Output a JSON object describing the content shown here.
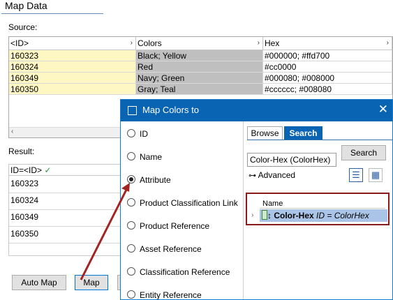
{
  "page": {
    "title": "Map Data"
  },
  "source": {
    "label": "Source:",
    "columns": [
      "<ID>",
      "Colors",
      "Hex"
    ],
    "rows": [
      {
        "id": "160323",
        "colors": "Black; Yellow",
        "hex": "#000000; #ffd700"
      },
      {
        "id": "160324",
        "colors": "Red",
        "hex": "#cc0000"
      },
      {
        "id": "160349",
        "colors": "Navy; Green",
        "hex": "#000080; #008000"
      },
      {
        "id": "160350",
        "colors": "Gray; Teal",
        "hex": "#cccccc; #008080"
      }
    ]
  },
  "result": {
    "label": "Result:",
    "header": "ID=<ID>",
    "header_check": "✓",
    "rows": [
      "160323",
      "160324",
      "160349",
      "160350"
    ]
  },
  "buttons": {
    "auto_map": "Auto Map",
    "map": "Map"
  },
  "dialog": {
    "title": "Map Colors to",
    "close": "✕",
    "options": [
      {
        "label": "ID",
        "selected": false
      },
      {
        "label": "Name",
        "selected": false
      },
      {
        "label": "Attribute",
        "selected": true
      },
      {
        "label": "Product Classification Link",
        "selected": false
      },
      {
        "label": "Product Reference",
        "selected": false
      },
      {
        "label": "Asset Reference",
        "selected": false
      },
      {
        "label": "Classification Reference",
        "selected": false
      },
      {
        "label": "Entity Reference",
        "selected": false
      }
    ],
    "tabs": {
      "browse": "Browse",
      "search": "Search"
    },
    "search_value": "Color-Hex (ColorHex)",
    "search_button": "Search",
    "advanced": "Advanced",
    "results": {
      "column": "Name",
      "item_name": "Color-Hex",
      "item_detail": "ID = ColorHex"
    }
  },
  "colors": {
    "accent": "#0a64b4",
    "highlight_border": "#8b1a1a",
    "source_id_bg": "#fef6c3",
    "selected_row": "#a9c4e6"
  }
}
